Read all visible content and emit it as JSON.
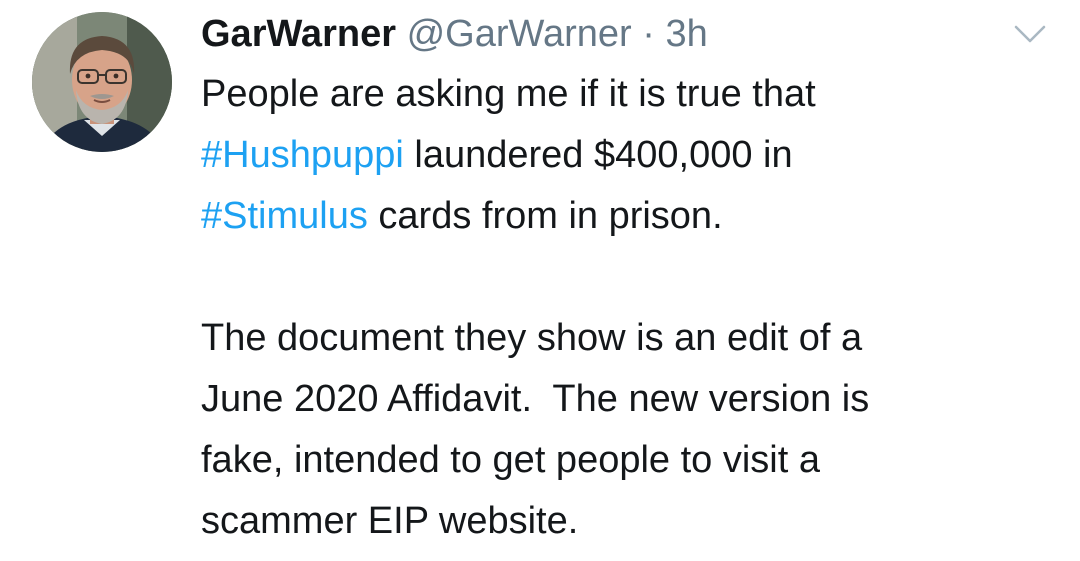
{
  "tweet": {
    "display_name": "GarWarner",
    "handle": "@GarWarner",
    "separator": " · ",
    "time": "3h",
    "line1": "People are asking me if it is true that",
    "hashtag1": "#Hushpuppi",
    "line2_rest": " laundered $400,000 in",
    "hashtag2": "#Stimulus",
    "line3_rest": " cards from in prison.",
    "line4": "The document they show is an edit of a",
    "line5": "June 2020 Affidavit.  The new version is",
    "line6": "fake, intended to get people to visit a",
    "line7": "scammer EIP website."
  },
  "icons": {
    "avatar": "profile-photo",
    "menu": "chevron-down-icon"
  },
  "colors": {
    "text": "#14171a",
    "secondary": "#657786",
    "link": "#1da1f2",
    "background": "#ffffff"
  }
}
